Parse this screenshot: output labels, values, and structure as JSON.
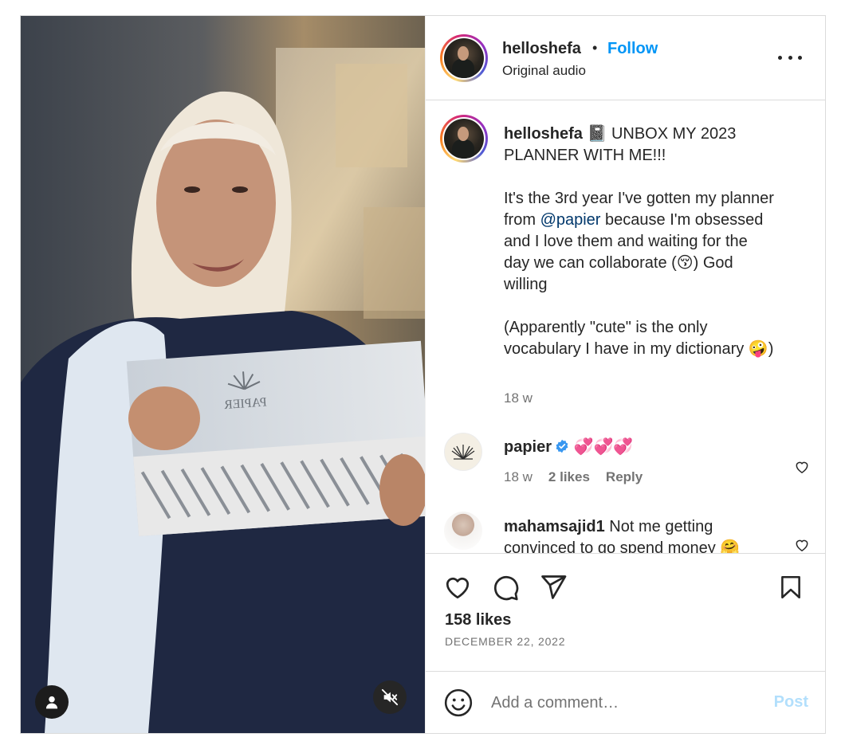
{
  "header": {
    "username": "helloshefa",
    "separator": "•",
    "follow_label": "Follow",
    "subtitle": "Original audio"
  },
  "caption": {
    "username": "helloshefa",
    "emoji": "📓",
    "line1": " UNBOX MY 2023 PLANNER WITH ME!!!",
    "para2_a": "It's the 3rd year I've gotten my planner from ",
    "mention": "@papier",
    "para2_b": " because I'm obsessed and I love them and waiting for the day we can collaborate (",
    "para2_emoji": "😚",
    "para2_c": ") God willing",
    "para3_a": "(Apparently \"cute\" is the only vocabulary I have in my dictionary ",
    "para3_emoji": "🤪",
    "para3_b": ")",
    "time": "18 w"
  },
  "comments": [
    {
      "username": "papier",
      "text": "💞💞💞",
      "time": "18 w",
      "likes": "2 likes",
      "reply": "Reply"
    },
    {
      "username": "mahamsajid1",
      "text": "Not me getting convinced to go spend money 🤗"
    }
  ],
  "stats": {
    "likes": "158 likes",
    "date": "DECEMBER 22, 2022"
  },
  "composer": {
    "placeholder": "Add a comment…",
    "post_label": "Post"
  },
  "media": {
    "box_brand": "PAPIER"
  },
  "colors": {
    "accent": "#0095f6",
    "post_disabled": "#b2dffc",
    "verified": "#3897f0",
    "muted_text": "#737373"
  },
  "icons": [
    "more-icon",
    "heart-icon",
    "comment-icon",
    "share-icon",
    "bookmark-icon",
    "emoji-icon",
    "user-tag-icon",
    "mute-icon",
    "verified-icon"
  ]
}
